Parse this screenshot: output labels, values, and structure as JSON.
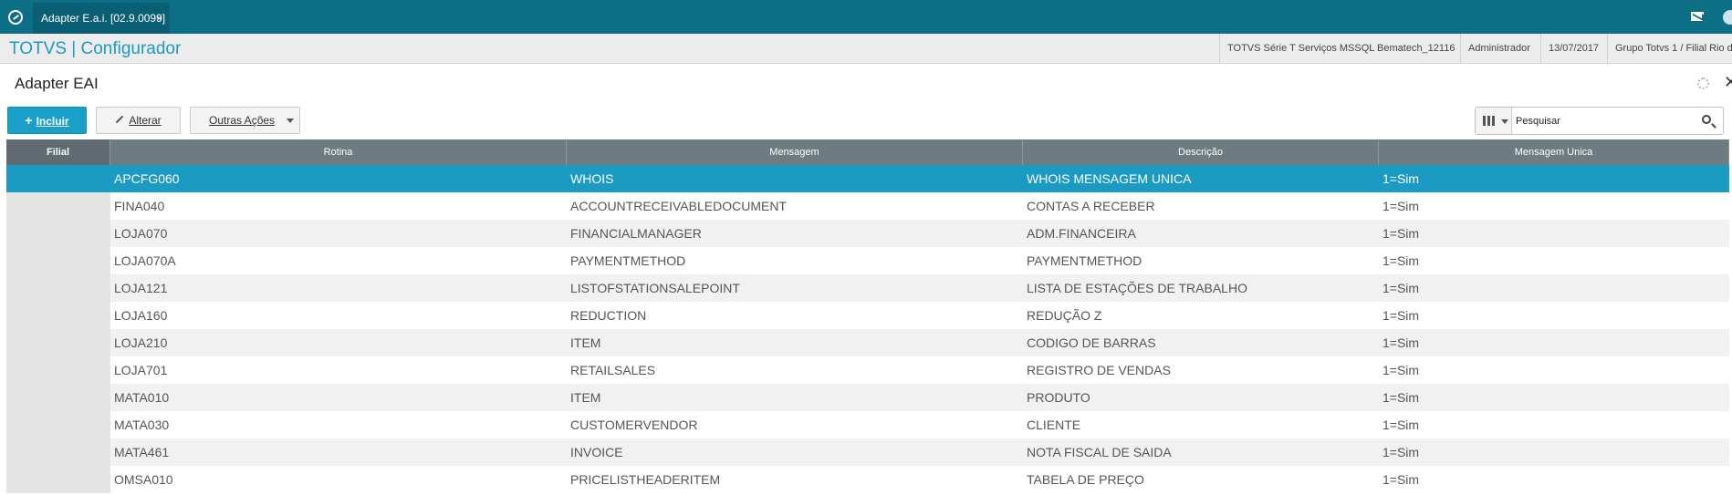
{
  "window": {
    "tab_title": "Adapter E.a.i. [02.9.0099]",
    "tab_close": "×",
    "icons": [
      "app-logo-icon",
      "close-icon",
      "mail-icon",
      "user-icon"
    ]
  },
  "header": {
    "brand": "TOTVS | Configurador",
    "server": "TOTVS Série T Serviços MSSQL Bematech_12116",
    "user": "Administrador",
    "date": "13/07/2017",
    "company": "Grupo Totvs 1 / Filial Rio de"
  },
  "page": {
    "title": "Adapter EAI",
    "close": "✕"
  },
  "toolbar": {
    "incluir": "Incluir",
    "alterar": "Alterar",
    "outras": "Outras Ações"
  },
  "search": {
    "placeholder": "Pesquisar"
  },
  "table": {
    "columns": [
      "Filial",
      "Rotina",
      "Mensagem",
      "Descrição",
      "Mensagem Unica"
    ],
    "rows": [
      {
        "filial": "",
        "rotina": "APCFG060",
        "mensagem": "WHOIS",
        "descricao": "WHOIS MENSAGEM UNICA",
        "unica": "1=Sim",
        "selected": true
      },
      {
        "filial": "",
        "rotina": "FINA040",
        "mensagem": "ACCOUNTRECEIVABLEDOCUMENT",
        "descricao": "CONTAS A RECEBER",
        "unica": "1=Sim"
      },
      {
        "filial": "",
        "rotina": "LOJA070",
        "mensagem": "FINANCIALMANAGER",
        "descricao": "ADM.FINANCEIRA",
        "unica": "1=Sim"
      },
      {
        "filial": "",
        "rotina": "LOJA070A",
        "mensagem": "PAYMENTMETHOD",
        "descricao": "PAYMENTMETHOD",
        "unica": "1=Sim"
      },
      {
        "filial": "",
        "rotina": "LOJA121",
        "mensagem": "LISTOFSTATIONSALEPOINT",
        "descricao": "LISTA DE ESTAÇÕES DE TRABALHO",
        "unica": "1=Sim"
      },
      {
        "filial": "",
        "rotina": "LOJA160",
        "mensagem": "REDUCTION",
        "descricao": "REDUÇÃO Z",
        "unica": "1=Sim"
      },
      {
        "filial": "",
        "rotina": "LOJA210",
        "mensagem": "ITEM",
        "descricao": "CODIGO DE BARRAS",
        "unica": "1=Sim"
      },
      {
        "filial": "",
        "rotina": "LOJA701",
        "mensagem": "RETAILSALES",
        "descricao": "REGISTRO DE VENDAS",
        "unica": "1=Sim"
      },
      {
        "filial": "",
        "rotina": "MATA010",
        "mensagem": "ITEM",
        "descricao": "PRODUTO",
        "unica": "1=Sim"
      },
      {
        "filial": "",
        "rotina": "MATA030",
        "mensagem": "CUSTOMERVENDOR",
        "descricao": "CLIENTE",
        "unica": "1=Sim"
      },
      {
        "filial": "",
        "rotina": "MATA461",
        "mensagem": "INVOICE",
        "descricao": "NOTA FISCAL DE SAIDA",
        "unica": "1=Sim"
      },
      {
        "filial": "",
        "rotina": "OMSA010",
        "mensagem": "PRICELISTHEADERITEM",
        "descricao": "TABELA DE PREÇO",
        "unica": "1=Sim"
      }
    ]
  },
  "colors": {
    "topbar": "#0d6f86",
    "accent": "#1aa0c8",
    "selected_row": "#1b9bc3",
    "table_header": "#6e7b80"
  }
}
